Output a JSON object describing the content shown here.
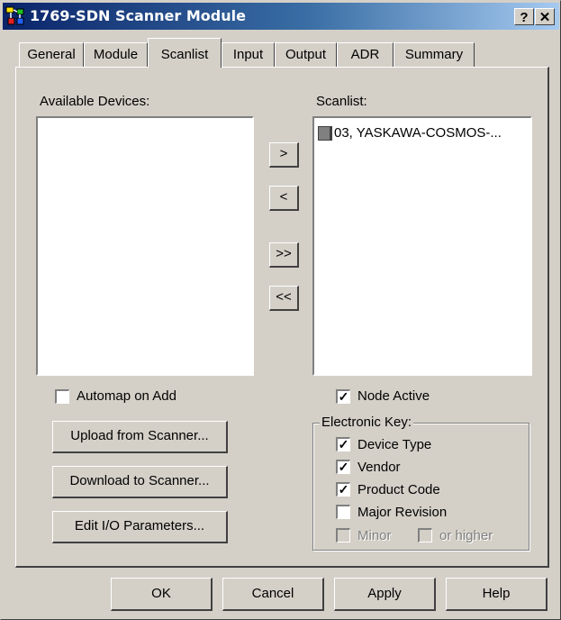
{
  "window": {
    "title": "1769-SDN Scanner Module",
    "help_btn": "?",
    "close_btn": "✕"
  },
  "tabs": [
    {
      "label": "General"
    },
    {
      "label": "Module"
    },
    {
      "label": "Scanlist"
    },
    {
      "label": "Input"
    },
    {
      "label": "Output"
    },
    {
      "label": "ADR"
    },
    {
      "label": "Summary"
    }
  ],
  "active_tab": "Scanlist",
  "available": {
    "label": "Available Devices:"
  },
  "scanlist": {
    "label": "Scanlist:",
    "items": [
      {
        "label": "03, YASKAWA-COSMOS-..."
      }
    ]
  },
  "transfer": {
    "add": ">",
    "remove": "<",
    "add_all": ">>",
    "remove_all": "<<"
  },
  "automap": {
    "label": "Automap on Add",
    "checked": false
  },
  "node_active": {
    "label": "Node Active",
    "checked": true
  },
  "buttons": {
    "upload": "Upload from Scanner...",
    "download": "Download to Scanner...",
    "edit_io": "Edit I/O Parameters..."
  },
  "electronic_key": {
    "label": "Electronic Key:",
    "device_type": "Device Type",
    "vendor": "Vendor",
    "product_code": "Product Code",
    "major_revision": "Major Revision",
    "minor": "Minor",
    "or_higher": "or higher"
  },
  "footer": {
    "ok": "OK",
    "cancel": "Cancel",
    "apply": "Apply",
    "help": "Help"
  },
  "colors": {
    "titlebar_start": "#0a246a",
    "titlebar_end": "#a6caf0",
    "face": "#d4d0c8"
  }
}
